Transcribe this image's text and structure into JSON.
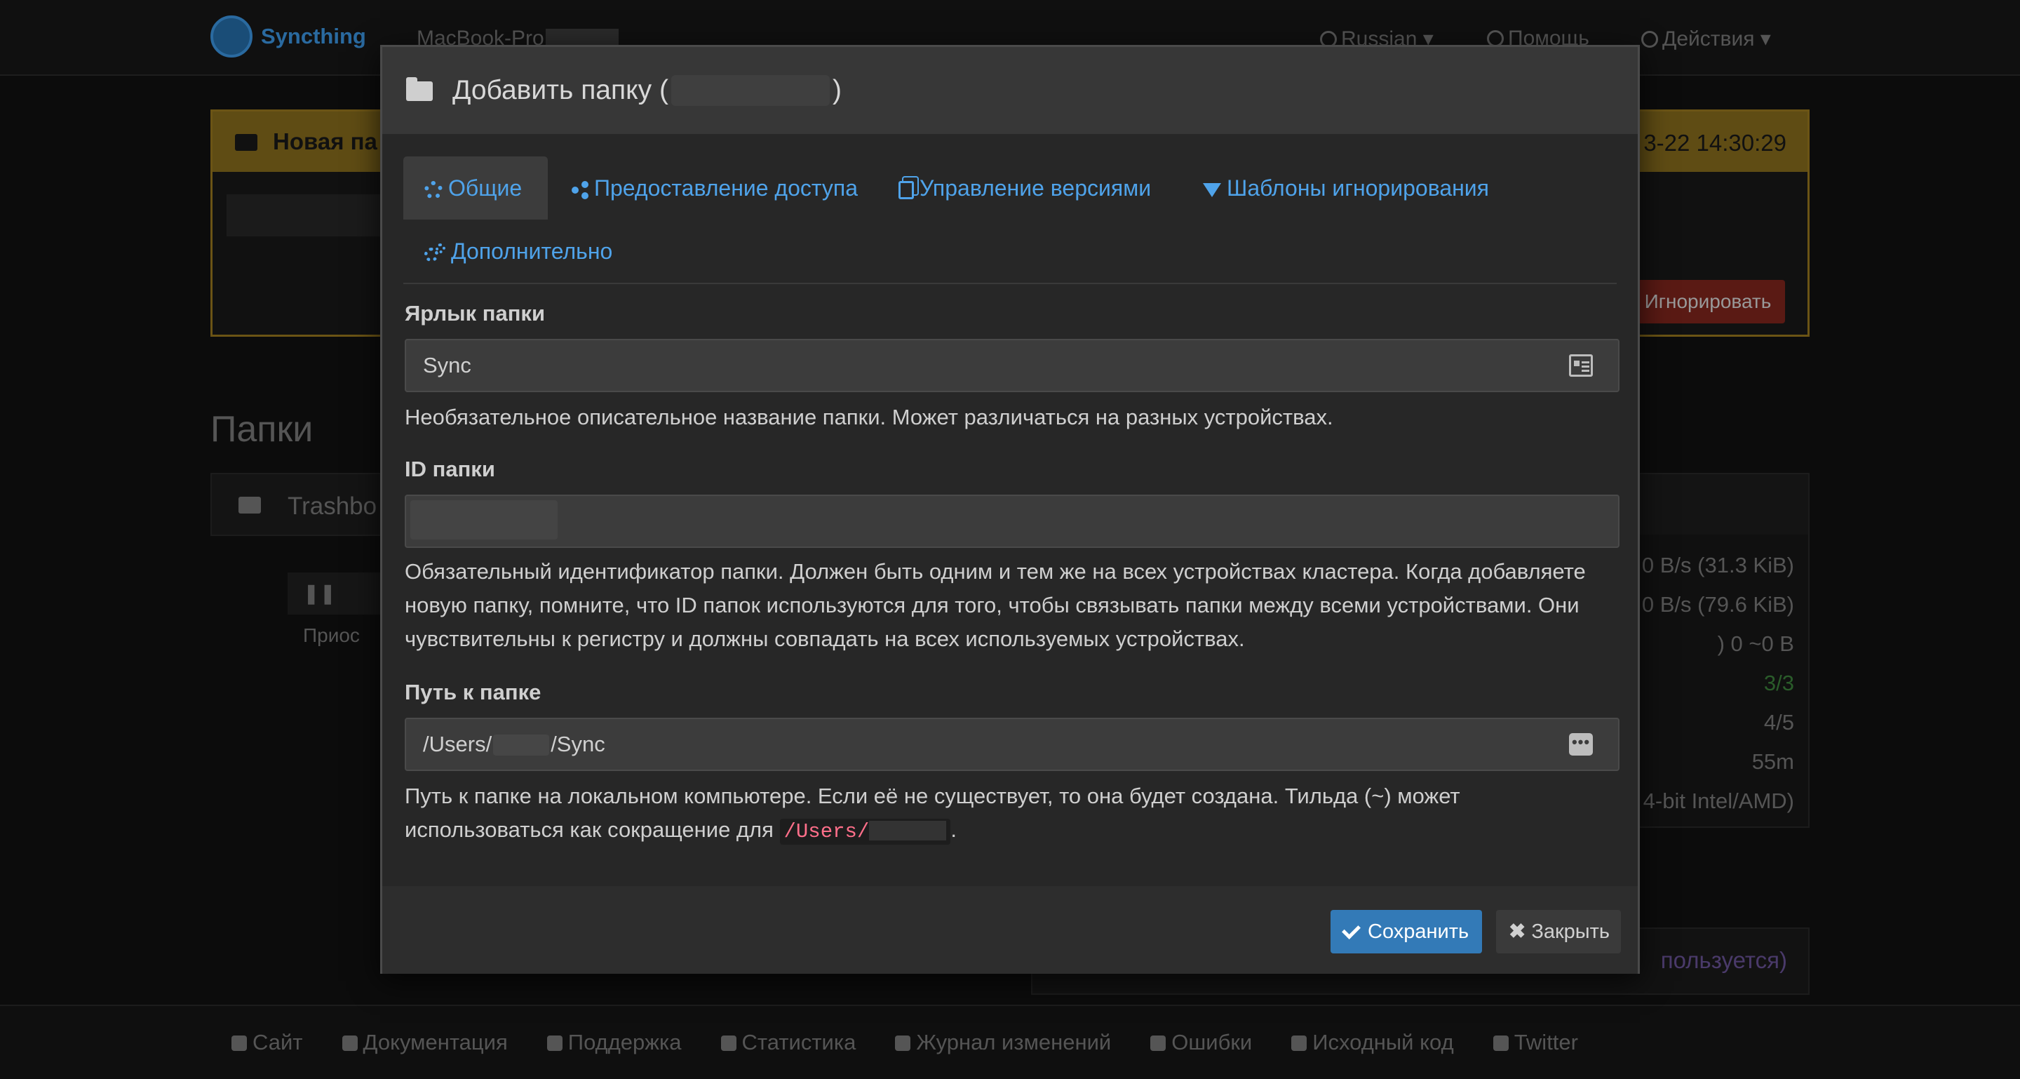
{
  "navbar": {
    "brand": "Syncthing",
    "device_name": "MacBook-Pro",
    "language": "Russian",
    "help": "Помощь",
    "actions": "Действия"
  },
  "background": {
    "notice_title": "Новая па",
    "notice_time": "3-22 14:30:29",
    "notice_ignore": "Игнорировать",
    "folders_title": "Папки",
    "folder_label": "Trashbo",
    "pause_label": "Приос",
    "stats": [
      "0 B/s (31.3 KiB)",
      "0 B/s (79.6 KiB)",
      ")  0  ~0 B",
      "3/3",
      "4/5",
      "55m",
      "4-bit Intel/AMD)"
    ],
    "bottom_panel": "пользуется)"
  },
  "footer": {
    "links": [
      "Сайт",
      "Документация",
      "Поддержка",
      "Статистика",
      "Журнал изменений",
      "Ошибки",
      "Исходный код",
      "Twitter"
    ]
  },
  "modal": {
    "title_prefix": "Добавить папку (",
    "title_suffix": ")",
    "tabs": {
      "general": "Общие",
      "sharing": "Предоставление доступа",
      "versioning": "Управление версиями",
      "ignore": "Шаблоны игнорирования",
      "advanced": "Дополнительно"
    },
    "label_field": {
      "label": "Ярлык папки",
      "value": "Sync",
      "help": "Необязательное описательное название папки. Может различаться на разных устройствах."
    },
    "id_field": {
      "label": "ID папки",
      "value": "",
      "help": "Обязательный идентификатор папки. Должен быть одним и тем же на всех устройствах кластера. Когда добавляете новую папку, помните, что ID папок используются для того, чтобы связывать папки между всеми устройствами. Они чувствительны к регистру и должны совпадать на всех используемых устройствах."
    },
    "path_field": {
      "label": "Путь к папке",
      "value_prefix": "/Users/",
      "value_suffix": "/Sync",
      "help_text": "Путь к папке на локальном компьютере. Если её не существует, то она будет создана. Тильда (~) может использоваться как сокращение для ",
      "home_code": "/Users/",
      "help_end": "."
    },
    "buttons": {
      "save": "Сохранить",
      "close": "Закрыть"
    }
  },
  "colors": {
    "accent": "#4fa3ea",
    "primary_button": "#337ab7",
    "code": "#ff6f8a"
  }
}
